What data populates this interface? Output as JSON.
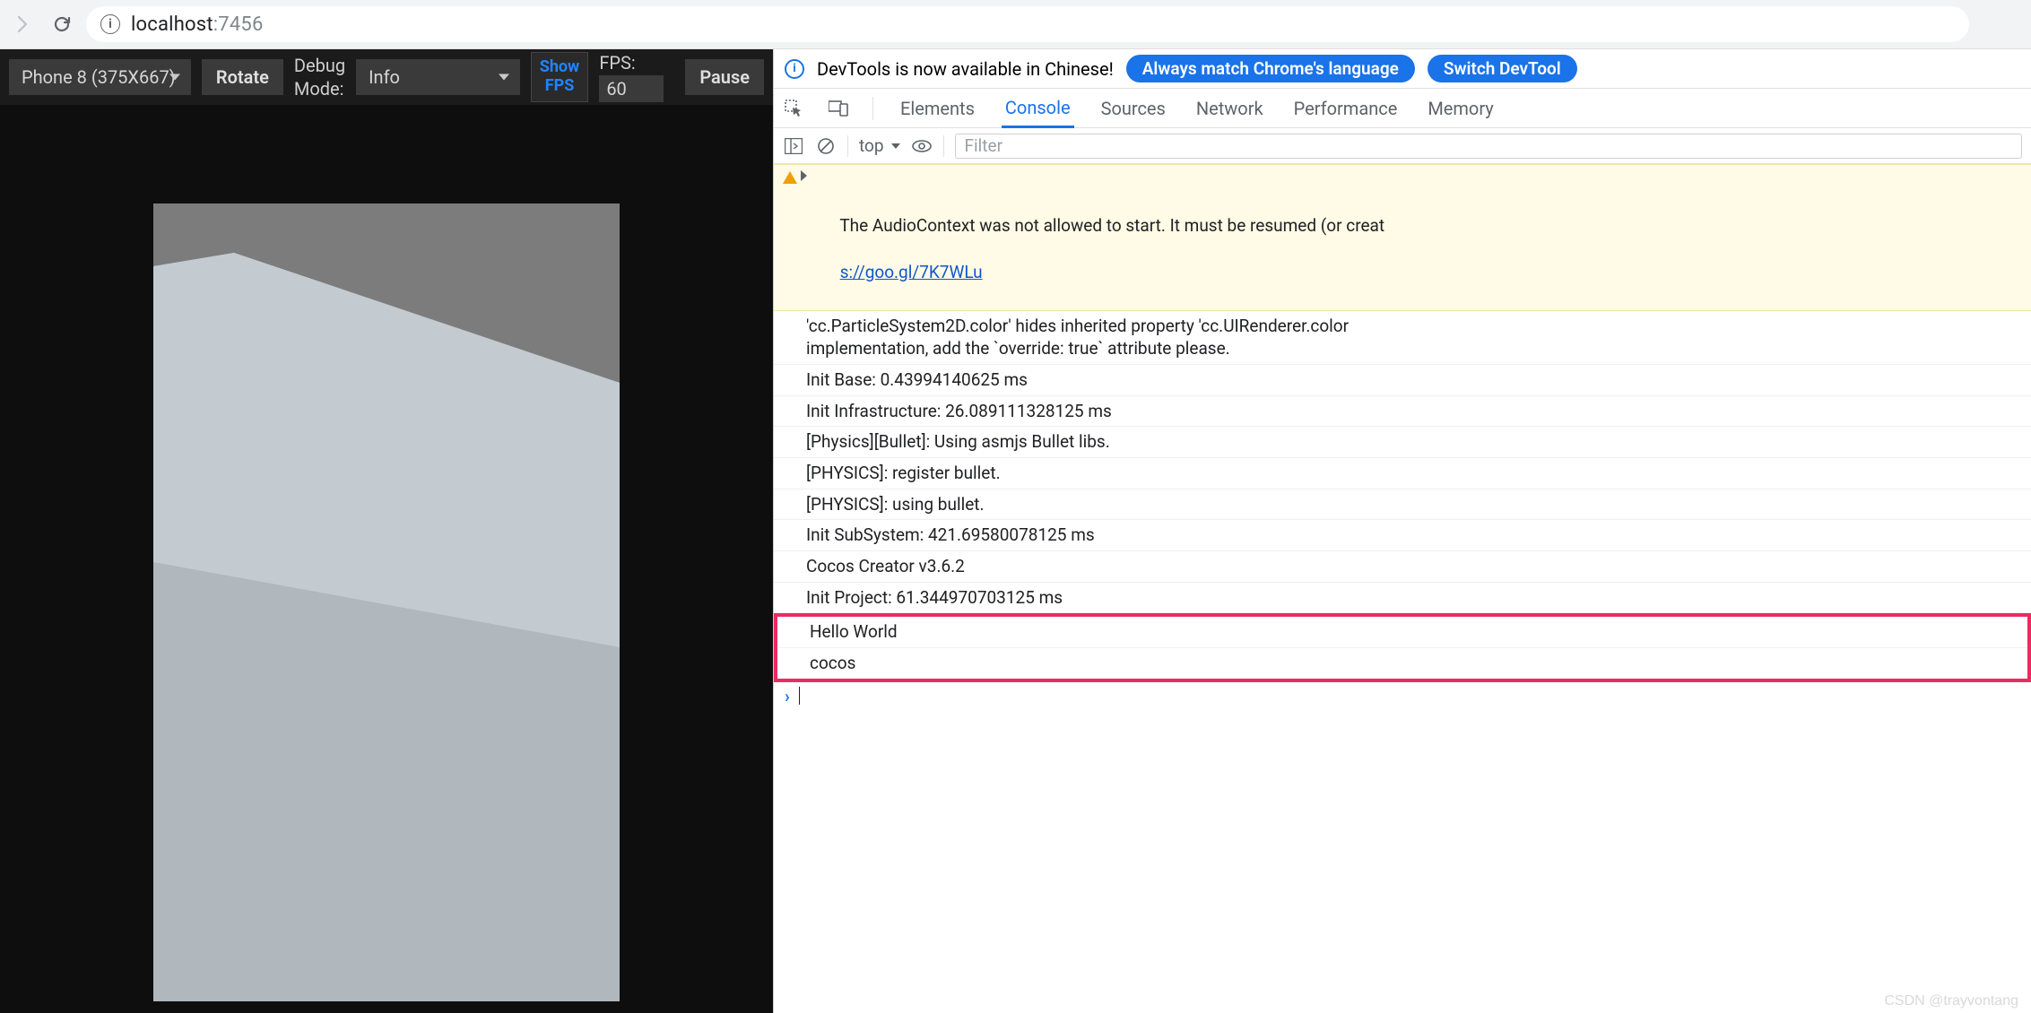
{
  "chrome": {
    "url_host": "localhost",
    "url_port": ":7456"
  },
  "preview_toolbar": {
    "device": "Phone 8 (375X667)",
    "rotate": "Rotate",
    "debug_mode_label_1": "Debug",
    "debug_mode_label_2": "Mode:",
    "debug_level": "Info",
    "show_fps_1": "Show",
    "show_fps_2": "FPS",
    "fps_label": "FPS:",
    "fps_value": "60",
    "pause": "Pause"
  },
  "devtools": {
    "notice_text": "DevTools is now available in Chinese!",
    "match_btn": "Always match Chrome's language",
    "switch_btn": "Switch DevTool",
    "tabs": {
      "elements": "Elements",
      "console": "Console",
      "sources": "Sources",
      "network": "Network",
      "performance": "Performance",
      "memory": "Memory"
    },
    "ctrl": {
      "context": "top",
      "filter_placeholder": "Filter"
    },
    "messages": {
      "warn_line1": "The AudioContext was not allowed to start. It must be resumed (or creat",
      "warn_link": "s://goo.gl/7K7WLu",
      "log1": "'cc.ParticleSystem2D.color' hides inherited property 'cc.UIRenderer.color\nimplementation, add the `override: true` attribute please.",
      "log2": "Init Base: 0.43994140625 ms",
      "log3": "Init Infrastructure: 26.089111328125 ms",
      "log4": "[Physics][Bullet]: Using asmjs Bullet libs.",
      "log5": "[PHYSICS]: register bullet.",
      "log6": "[PHYSICS]: using bullet.",
      "log7": "Init SubSystem: 421.69580078125 ms",
      "log8": "Cocos Creator v3.6.2",
      "log9": "Init Project: 61.344970703125 ms",
      "log10": "Hello World",
      "log11": "cocos"
    }
  },
  "watermark": "CSDN @trayvontang"
}
